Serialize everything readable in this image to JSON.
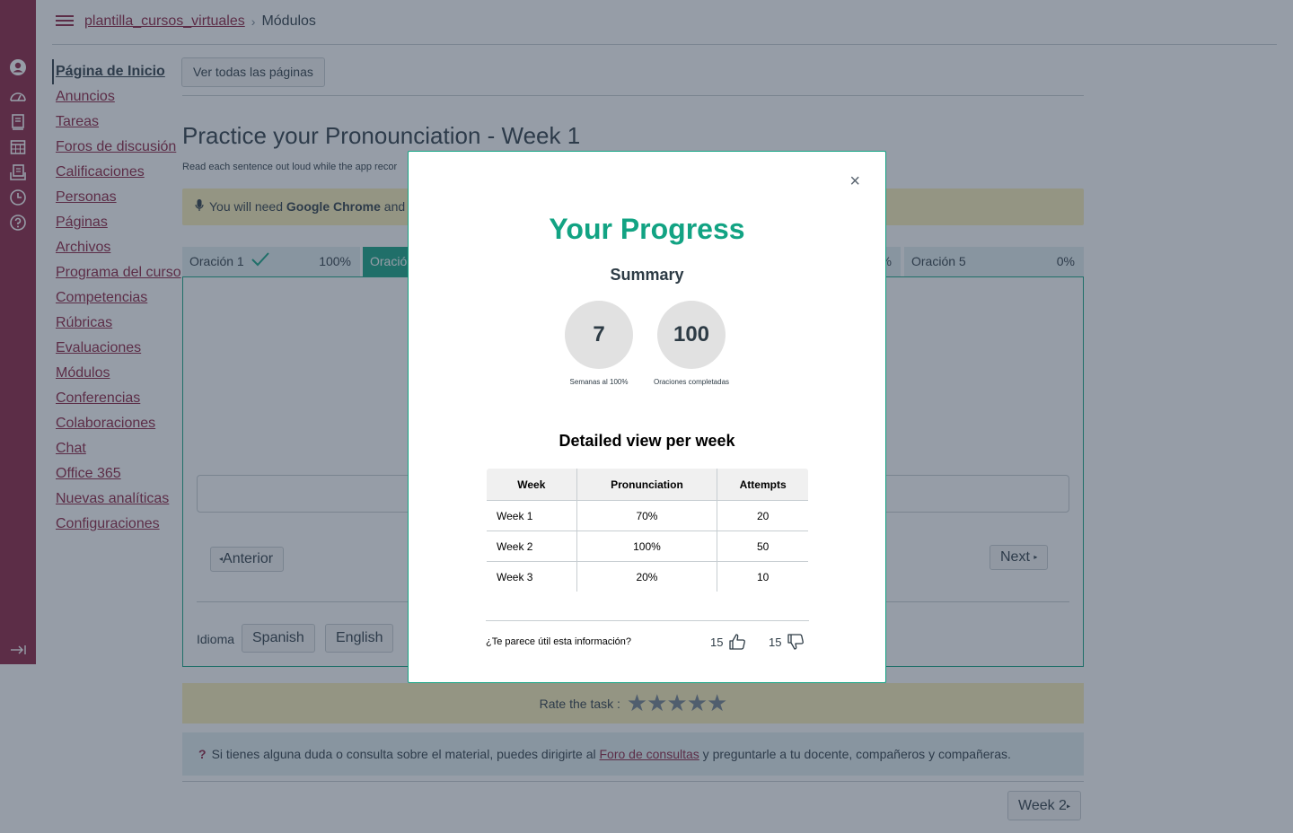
{
  "breadcrumb": {
    "course": "plantilla_cursos_virtuales",
    "current": "Módulos"
  },
  "course_nav": [
    "Página de Inicio",
    "Anuncios",
    "Tareas",
    "Foros de discusión",
    "Calificaciones",
    "Personas",
    "Páginas",
    "Archivos",
    "Programa del curso",
    "Competencias",
    "Rúbricas",
    "Evaluaciones",
    "Módulos",
    "Conferencias",
    "Colaboraciones",
    "Chat",
    "Office 365",
    "Nuevas analíticas",
    "Configuraciones"
  ],
  "main": {
    "view_all_label": "Ver todas las páginas",
    "title": "Practice your Pronounciation - Week 1",
    "intro": "Read each sentence out loud while the app recor",
    "notice_prefix": "You will need ",
    "notice_bold": "Google Chrome",
    "notice_suffix": " and a",
    "tabs": [
      {
        "label": "Oración 1",
        "pct": "100%"
      },
      {
        "label": "Oració",
        "pct": ""
      },
      {
        "label": "",
        "pct": "%"
      },
      {
        "label": "Oración 5",
        "pct": "0%"
      }
    ],
    "prev_label": "Anterior",
    "next_label": "Next",
    "language_label": "Idioma",
    "lang_spanish": "Spanish",
    "lang_english": "English",
    "rate_label": "Rate the task :",
    "rating": 0,
    "help_prefix": "Si tienes alguna duda o consulta sobre el material, puedes dirigirte al ",
    "help_link": "Foro de consultas",
    "help_suffix": " y preguntarle a tu docente, compañeros y compañeras.",
    "week2_label": "Week 2"
  },
  "modal": {
    "title": "Your Progress",
    "summary_title": "Summary",
    "stats": [
      {
        "value": "7",
        "caption": "Semanas al 100%"
      },
      {
        "value": "100",
        "caption": "Oraciones completadas"
      }
    ],
    "detail_title": "Detailed view per week",
    "table": {
      "headers": [
        "Week",
        "Pronunciation",
        "Attempts"
      ],
      "rows": [
        [
          "Week 1",
          "70%",
          "20"
        ],
        [
          "Week 2",
          "100%",
          "50"
        ],
        [
          "Week 3",
          "20%",
          "10"
        ]
      ]
    },
    "feedback_question": "¿Te parece útil esta información?",
    "likes": "15",
    "dislikes": "15",
    "close_label": "×"
  },
  "colors": {
    "brand": "#8b1e3f",
    "accent": "#12a383",
    "yellow": "#fbeeb6",
    "teal_light": "#e3eef0"
  }
}
